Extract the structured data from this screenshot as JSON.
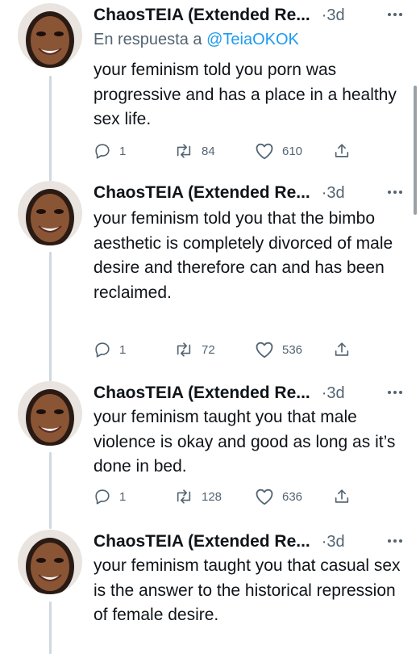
{
  "colors": {
    "text": "#0f1419",
    "secondary": "#536471",
    "link": "#1d9bf0",
    "thread_line": "#cfd9de"
  },
  "icons": [
    "more-icon",
    "reply-icon",
    "retweet-icon",
    "like-icon",
    "share-icon"
  ],
  "tweets": [
    {
      "name": "ChaosTEIA (Extended Re...",
      "time": "·3d",
      "reply_prefix": "En respuesta a",
      "reply_handle": "@TeiaOKOK",
      "text": "your feminism told you porn was progressive and has a place in a healthy sex life.",
      "replies": "1",
      "retweets": "84",
      "likes": "610"
    },
    {
      "name": "ChaosTEIA (Extended Re...",
      "time": "·3d",
      "text": "your feminism told you that the bimbo aesthetic is completely divorced of male desire and therefore can and has been reclaimed.",
      "replies": "1",
      "retweets": "72",
      "likes": "536"
    },
    {
      "name": "ChaosTEIA (Extended Re...",
      "time": "·3d",
      "text": "your feminism taught you that male violence is okay and good as long as it’s done in bed.",
      "replies": "1",
      "retweets": "128",
      "likes": "636"
    },
    {
      "name": "ChaosTEIA (Extended Re...",
      "time": "·3d",
      "text": "your feminism taught you that casual sex is the answer to the historical repression of female desire."
    }
  ]
}
